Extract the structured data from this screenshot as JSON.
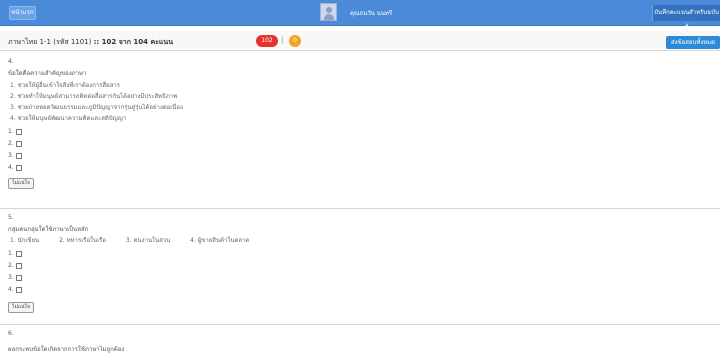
{
  "topbar": {
    "left_button": "หน้าแรก",
    "username": "คุณธนวัน นนทรี",
    "right_button": "บันทึกคะแนนสำหรับฉบับนี้"
  },
  "subbar": {
    "course_title_prefix": "ภาษาไทย 1-1",
    "course_code": "(รหัส 1101)",
    "progress_text": ":: 102 จาก 104 คะแนน",
    "badge_count": "102",
    "badge_sep": "|",
    "badge_dot": "0",
    "submit_button": "ส่งข้อสอบทั้งหมด"
  },
  "questions": [
    {
      "number": "4.",
      "text": "ข้อใดคือความสำคัญของภาษา",
      "options": [
        "1.  ช่วยให้ผู้อื่นเข้าใจสิ่งที่เราต้องการสื่อสาร",
        "2.  ช่วยทำให้มนุษย์สามารถติดต่อสื่อสารกันได้อย่างมีประสิทธิภาพ",
        "3.  ช่วยถ่ายทอดวัฒนธรรมและภูมิปัญญาจากรุ่นสู่รุ่นได้อย่างต่อเนื่อง",
        "4.  ช่วยให้มนุษย์พัฒนาความคิดและสติปัญญา"
      ],
      "answers": [
        "1.",
        "2.",
        "3.",
        "4."
      ],
      "nosure": "ไม่แน่ใจ"
    },
    {
      "number": "5.",
      "text": "กลุ่มคนกลุ่มใดใช้ภาษาเป็นหลัก",
      "options": [
        "1. นักเขียน",
        "2. ทหารเรือในเรือ",
        "3. คนงานในสวน",
        "4. ผู้ขายสินค้าในตลาด"
      ],
      "answers": [
        "1.",
        "2.",
        "3.",
        "4."
      ],
      "nosure": "ไม่แน่ใจ"
    },
    {
      "number": "6.",
      "text": "ผลกระทบข้อใดเกิดจากการใช้ภาษาไม่ถูกต้อง"
    }
  ]
}
